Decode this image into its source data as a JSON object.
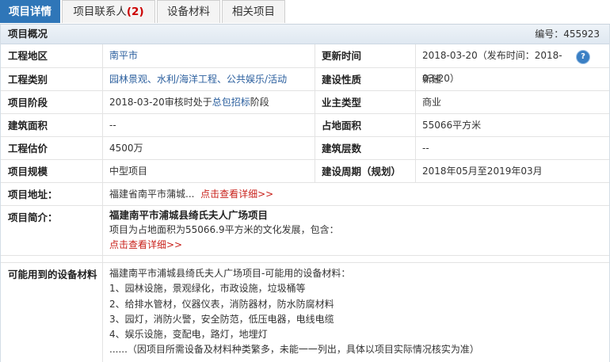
{
  "tabs": [
    {
      "label": "项目详情",
      "active": true
    },
    {
      "label": "项目联系人",
      "count": "(2)"
    },
    {
      "label": "设备材料"
    },
    {
      "label": "相关项目"
    }
  ],
  "overview": {
    "title": "项目概况",
    "number_text": "编号：455923"
  },
  "labels": {
    "region": "工程地区",
    "update_time": "更新时间",
    "category": "工程类别",
    "nature": "建设性质",
    "stage": "项目阶段",
    "owner_type": "业主类型",
    "build_area": "建筑面积",
    "land_area": "占地面积",
    "estimate": "工程估价",
    "floors": "建筑层数",
    "scale": "项目规模",
    "period": "建设周期（规划）",
    "address": "项目地址：",
    "intro": "项目简介：",
    "materials": "可能用到的设备材料"
  },
  "values": {
    "region": "南平市",
    "update_time": "2018-03-20（发布时间：2018-03-20）",
    "category": "园林景观、水利/海洋工程、公共娱乐/活动",
    "nature": "新建",
    "stage_prefix": "2018-03-20审核时处于",
    "stage_link": "总包招标",
    "stage_suffix": "阶段",
    "owner_type": "商业",
    "build_area": "--",
    "land_area": "55066平方米",
    "estimate": "4500万",
    "floors": "--",
    "scale": "中型项目",
    "period": "2018年05月至2019年03月",
    "address": "福建省南平市蒲城...",
    "address_link": "点击查看详细>>",
    "intro_title": "福建南平市浦城县绮氏夫人广场项目",
    "intro_text": "项目为占地面积为55066.9平方米的文化发展，包含：",
    "intro_link": "点击查看详细>>"
  },
  "materials": {
    "intro": "福建南平市浦城县绮氏夫人广场项目-可能用的设备材料：",
    "items": [
      "1、园林设施，景观绿化，市政设施，垃圾桶等",
      "2、给排水管材，仪器仪表，消防器材，防水防腐材料",
      "3、园灯，消防火警，安全防范，低压电器，电线电缆",
      "4、娱乐设施，变配电，路灯，地埋灯"
    ],
    "note": "......（因项目所需设备及材料种类繁多，未能一一列出，具体以项目实际情况核实为准）"
  },
  "icons": {
    "info": "help-info-icon"
  },
  "colors": {
    "tab_active": "#2f76b8",
    "link": "#2b5f9e",
    "red_link": "#c8201a"
  }
}
